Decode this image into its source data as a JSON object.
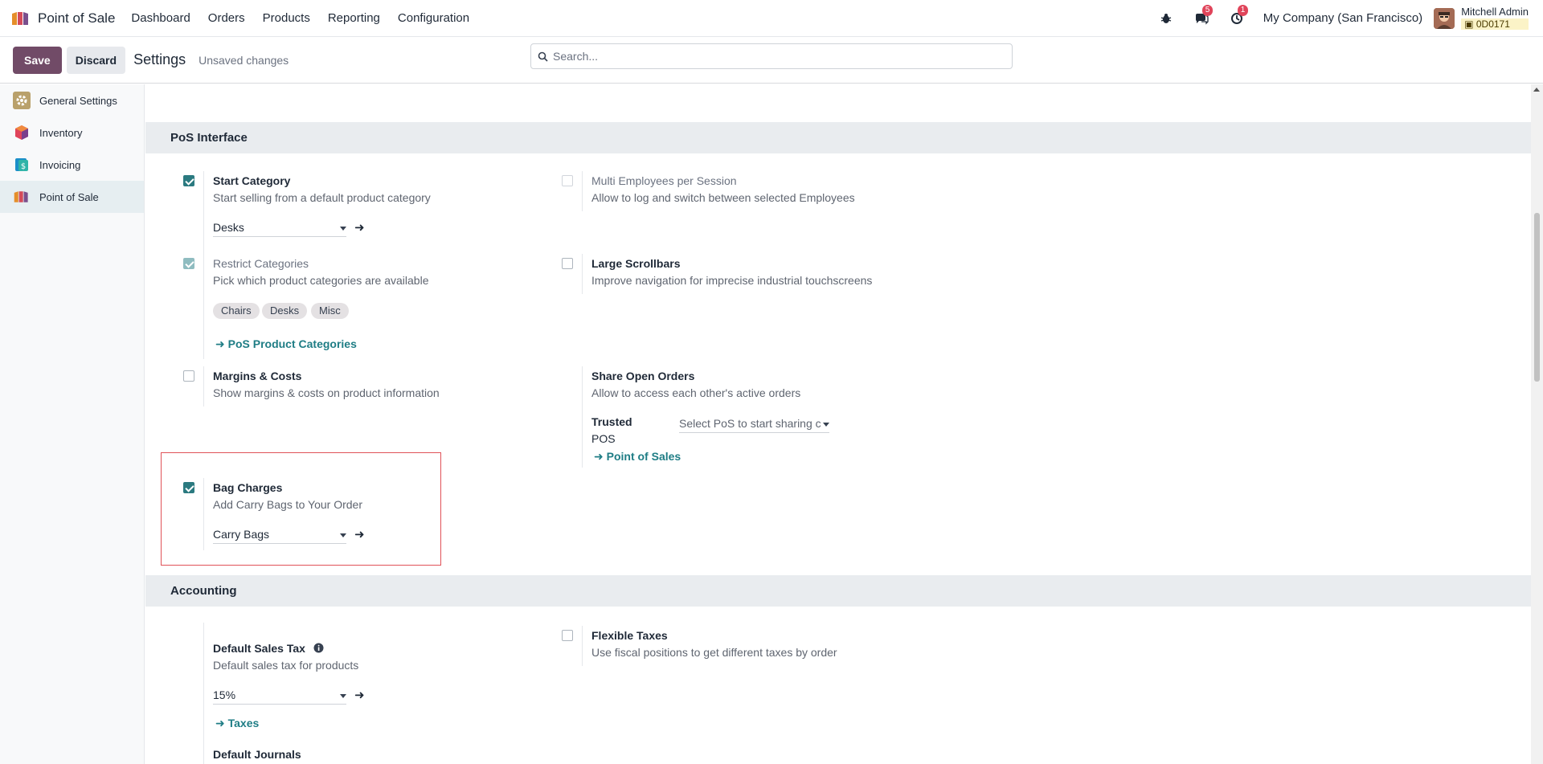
{
  "app": {
    "name": "Point of Sale"
  },
  "menu": [
    "Dashboard",
    "Orders",
    "Products",
    "Reporting",
    "Configuration"
  ],
  "navbar": {
    "messages_count": "5",
    "activities_count": "1",
    "company": "My Company (San Francisco)",
    "user_name": "Mitchell Admin",
    "db": "0D0171"
  },
  "control": {
    "save": "Save",
    "discard": "Discard",
    "title": "Settings",
    "unsaved": "Unsaved changes",
    "search_placeholder": "Search..."
  },
  "sidebar": [
    {
      "label": "General Settings",
      "icon": "gear-icon"
    },
    {
      "label": "Inventory",
      "icon": "inventory-icon"
    },
    {
      "label": "Invoicing",
      "icon": "invoicing-icon"
    },
    {
      "label": "Point of Sale",
      "icon": "pos-icon"
    }
  ],
  "pos_interface": {
    "title": "PoS Interface",
    "start_category": {
      "title": "Start Category",
      "desc": "Start selling from a default product category",
      "value": "Desks",
      "checked": true
    },
    "multi_employees": {
      "title": "Multi Employees per Session",
      "desc": "Allow to log and switch between selected Employees",
      "checked": false
    },
    "restrict_categories": {
      "title": "Restrict Categories",
      "desc": "Pick which product categories are available",
      "tags": [
        "Chairs",
        "Desks",
        "Misc"
      ],
      "link": "PoS Product Categories",
      "checked": true
    },
    "large_scrollbars": {
      "title": "Large Scrollbars",
      "desc": "Improve navigation for imprecise industrial touchscreens",
      "checked": false
    },
    "margins_costs": {
      "title": "Margins & Costs",
      "desc": "Show margins & costs on product information",
      "checked": false
    },
    "share_open_orders": {
      "title": "Share Open Orders",
      "desc": "Allow to access each other's active orders",
      "trusted_label_1": "Trusted",
      "trusted_label_2": "POS",
      "trusted_placeholder": "Select PoS to start sharing c",
      "link": "Point of Sales"
    },
    "bag_charges": {
      "title": "Bag Charges",
      "desc": "Add Carry Bags to Your Order",
      "value": "Carry Bags",
      "checked": true
    }
  },
  "accounting": {
    "title": "Accounting",
    "default_sales_tax": {
      "title": "Default Sales Tax",
      "desc": "Default sales tax for products",
      "value": "15%",
      "link": "Taxes"
    },
    "flexible_taxes": {
      "title": "Flexible Taxes",
      "desc": "Use fiscal positions to get different taxes by order",
      "checked": false
    },
    "default_journals": {
      "title": "Default Journals"
    }
  }
}
